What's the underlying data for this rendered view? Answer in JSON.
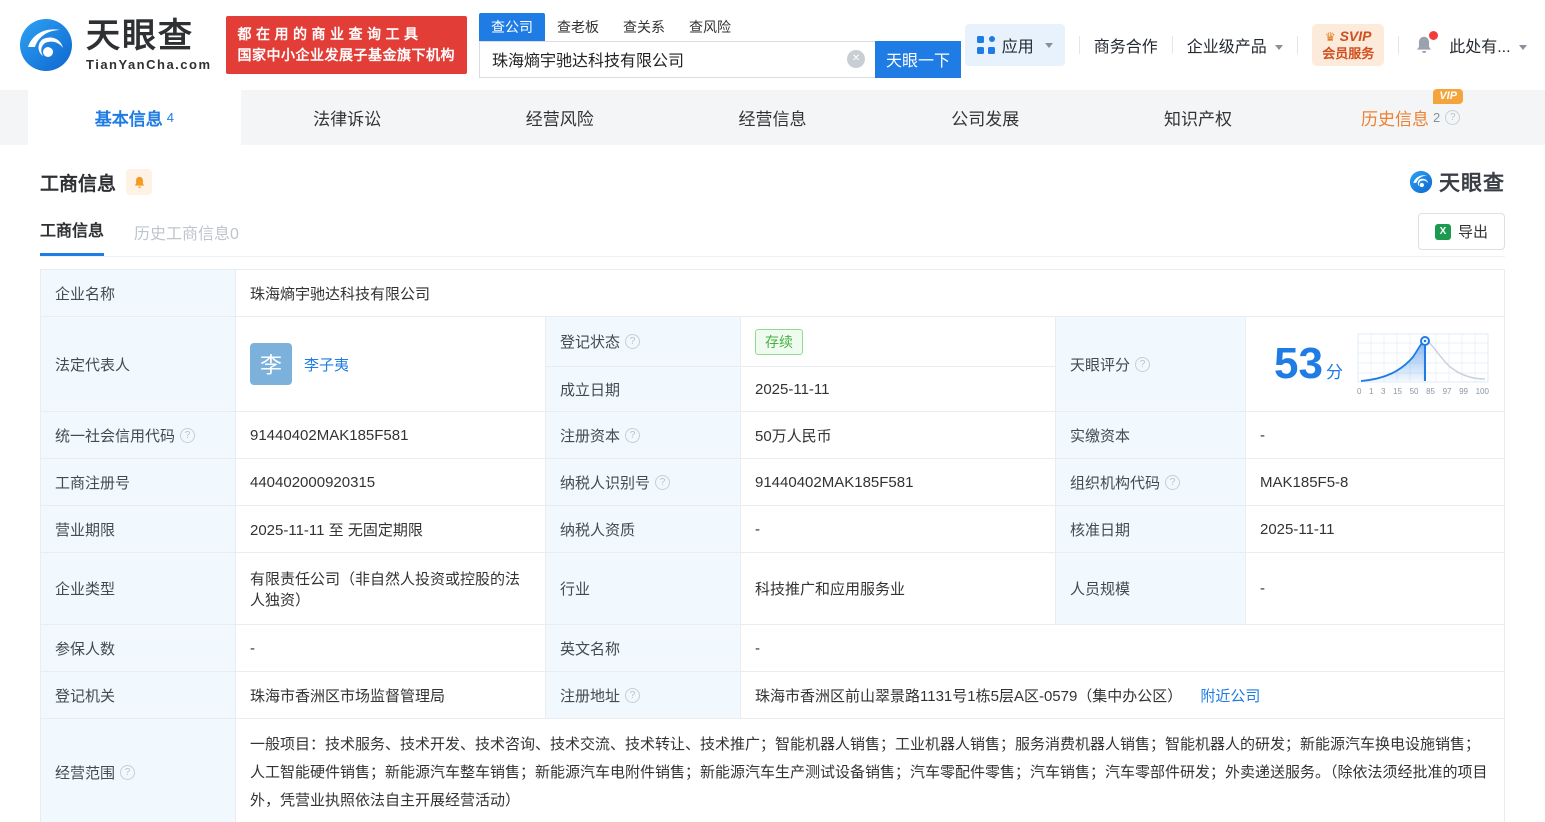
{
  "brand": {
    "name": "天眼查",
    "domain": "TianYanCha.com",
    "slogan_line1": "都在用的商业查询工具",
    "slogan_line2": "国家中小企业发展子基金旗下机构"
  },
  "icons": {
    "clear": "✕",
    "help": "?",
    "crown": "♛",
    "excel": "X"
  },
  "search": {
    "tabs": [
      "查公司",
      "查老板",
      "查关系",
      "查风险"
    ],
    "query": "珠海熵宇驰达科技有限公司",
    "button": "天眼一下"
  },
  "header_right": {
    "apps": "应用",
    "cooperation": "商务合作",
    "enterprise": "企业级产品",
    "svip_top": "SVIP",
    "svip_bottom": "会员服务",
    "user": "此处有..."
  },
  "nav": {
    "tabs": [
      {
        "label": "基本信息",
        "count": "4"
      },
      {
        "label": "法律诉讼",
        "count": ""
      },
      {
        "label": "经营风险",
        "count": ""
      },
      {
        "label": "经营信息",
        "count": ""
      },
      {
        "label": "公司发展",
        "count": ""
      },
      {
        "label": "知识产权",
        "count": ""
      },
      {
        "label": "历史信息",
        "count": "2",
        "vip": "VIP"
      }
    ]
  },
  "section": {
    "title": "工商信息",
    "brand_small": "天眼查",
    "subtab_active": "工商信息",
    "subtab_history": "历史工商信息0",
    "export_label": "导出"
  },
  "fields": {
    "company_name": {
      "label": "企业名称",
      "value": "珠海熵宇驰达科技有限公司"
    },
    "legal_rep": {
      "label": "法定代表人",
      "avatar": "李",
      "name": "李子夷"
    },
    "reg_status": {
      "label": "登记状态",
      "value": "存续"
    },
    "est_date": {
      "label": "成立日期",
      "value": "2025-11-11"
    },
    "score": {
      "label": "天眼评分",
      "value": "53",
      "unit": "分",
      "axis": [
        "0",
        "1",
        "3",
        "15",
        "50",
        "85",
        "97",
        "99",
        "100"
      ]
    },
    "credit_code": {
      "label": "统一社会信用代码",
      "value": "91440402MAK185F581"
    },
    "reg_capital": {
      "label": "注册资本",
      "value": "50万人民币"
    },
    "paid_capital": {
      "label": "实缴资本",
      "value": "-"
    },
    "reg_number": {
      "label": "工商注册号",
      "value": "440402000920315"
    },
    "taxpayer_id": {
      "label": "纳税人识别号",
      "value": "91440402MAK185F581"
    },
    "org_code": {
      "label": "组织机构代码",
      "value": "MAK185F5-8"
    },
    "business_term": {
      "label": "营业期限",
      "value": "2025-11-11 至 无固定期限"
    },
    "taxpayer_quality": {
      "label": "纳税人资质",
      "value": "-"
    },
    "approval_date": {
      "label": "核准日期",
      "value": "2025-11-11"
    },
    "company_type": {
      "label": "企业类型",
      "value": "有限责任公司（非自然人投资或控股的法人独资）"
    },
    "industry": {
      "label": "行业",
      "value": "科技推广和应用服务业"
    },
    "staff_size": {
      "label": "人员规模",
      "value": "-"
    },
    "insured_count": {
      "label": "参保人数",
      "value": "-"
    },
    "english_name": {
      "label": "英文名称",
      "value": "-"
    },
    "reg_authority": {
      "label": "登记机关",
      "value": "珠海市香洲区市场监督管理局"
    },
    "reg_address": {
      "label": "注册地址",
      "value": "珠海市香洲区前山翠景路1131号1栋5层A区-0579（集中办公区）",
      "nearby": "附近公司"
    },
    "business_scope": {
      "label": "经营范围",
      "value": "一般项目：技术服务、技术开发、技术咨询、技术交流、技术转让、技术推广；智能机器人销售；工业机器人销售；服务消费机器人销售；智能机器人的研发；新能源汽车换电设施销售；人工智能硬件销售；新能源汽车整车销售；新能源汽车电附件销售；新能源汽车生产测试设备销售；汽车零配件零售；汽车销售；汽车零部件研发；外卖递送服务。（除依法须经批准的项目外，凭营业执照依法自主开展经营活动）"
    }
  }
}
